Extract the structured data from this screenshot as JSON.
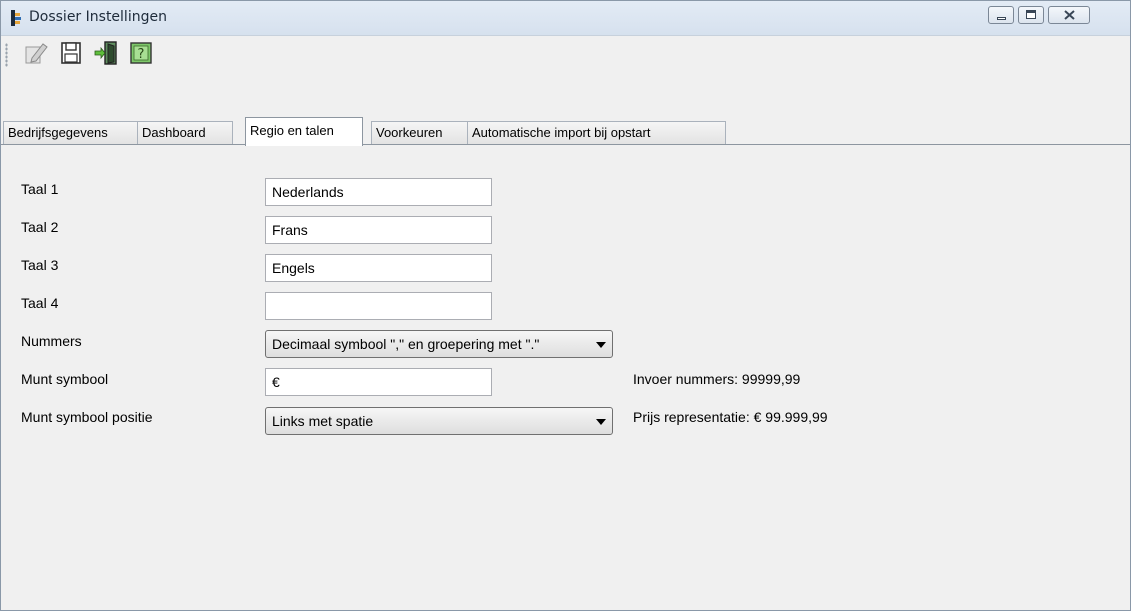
{
  "window": {
    "title": "Dossier Instellingen"
  },
  "toolbar": {
    "buttons": [
      {
        "icon": "edit-icon"
      },
      {
        "icon": "save-icon"
      },
      {
        "icon": "exit-icon"
      },
      {
        "icon": "help-icon"
      }
    ]
  },
  "tabs": [
    {
      "label": "Bedrijfsgegevens",
      "active": false
    },
    {
      "label": "Dashboard",
      "active": false
    },
    {
      "label": "Regio en talen",
      "active": true
    },
    {
      "label": "Voorkeuren",
      "active": false
    },
    {
      "label": "Automatische import bij opstart",
      "active": false
    }
  ],
  "form": {
    "taal1": {
      "label": "Taal 1",
      "value": "Nederlands"
    },
    "taal2": {
      "label": "Taal 2",
      "value": "Frans"
    },
    "taal3": {
      "label": "Taal 3",
      "value": "Engels"
    },
    "taal4": {
      "label": "Taal 4",
      "value": ""
    },
    "nummers": {
      "label": "Nummers",
      "value": "Decimaal symbool \",\" en groepering met \".\""
    },
    "munt_symbool": {
      "label": "Munt symbool",
      "value": "€"
    },
    "munt_positie": {
      "label": "Munt symbool positie",
      "value": "Links met spatie"
    }
  },
  "info": {
    "invoer": "Invoer nummers: 99999,99",
    "prijs": "Prijs representatie: € 99.999,99"
  },
  "colors": {
    "titlebar": "#dbe5f1",
    "help_green": "#7ec86a"
  }
}
